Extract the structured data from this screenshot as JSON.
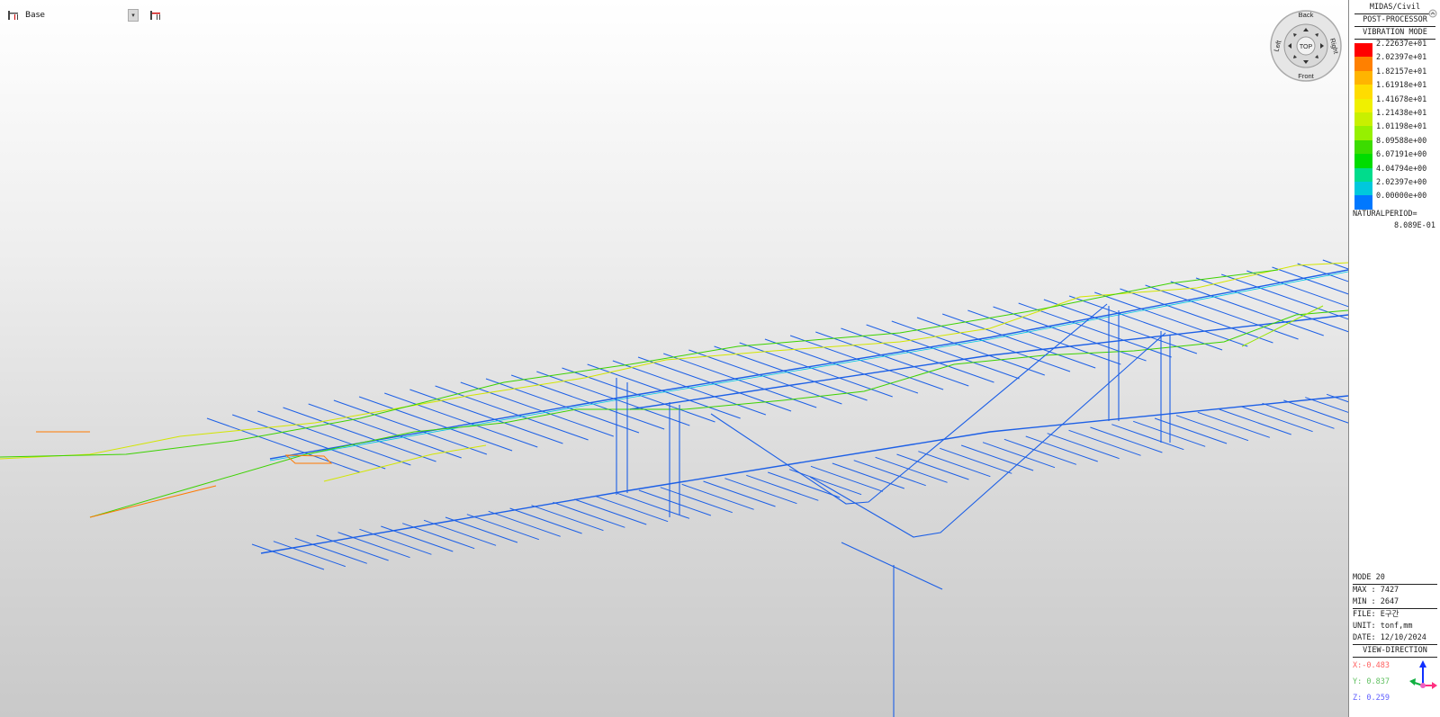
{
  "toolbar": {
    "layer_label": "Base",
    "layer_icon": "layer-icon",
    "layer_tool_icon": "layer-tool-icon",
    "dropdown_icon": "chevron-down-icon"
  },
  "navcube": {
    "back": "Back",
    "front": "Front",
    "left": "Left",
    "right": "Right",
    "top": "TOP"
  },
  "legend": {
    "title1": "MIDAS/Civil",
    "title2": "POST-PROCESSOR",
    "title3": "VIBRATION MODE",
    "scale": [
      {
        "value": "2.22637e+01",
        "color": "#ff0000"
      },
      {
        "value": "2.02397e+01",
        "color": "#ff8000"
      },
      {
        "value": "1.82157e+01",
        "color": "#ffb400"
      },
      {
        "value": "1.61918e+01",
        "color": "#ffdc00"
      },
      {
        "value": "1.41678e+01",
        "color": "#f0f000"
      },
      {
        "value": "1.21438e+01",
        "color": "#c8f000"
      },
      {
        "value": "1.01198e+01",
        "color": "#96f000"
      },
      {
        "value": "8.09588e+00",
        "color": "#3cdc00"
      },
      {
        "value": "6.07191e+00",
        "color": "#00dc00"
      },
      {
        "value": "4.04794e+00",
        "color": "#00dc8c"
      },
      {
        "value": "2.02397e+00",
        "color": "#00c8dc"
      },
      {
        "value": "0.00000e+00",
        "color": "#0078ff"
      }
    ],
    "natural_period_label": "NATURALPERIOD=",
    "natural_period_value": "8.089E-01",
    "mode": "MODE 20",
    "max": "MAX : 7427",
    "min": "MIN : 2647",
    "file": "FILE: E구간",
    "unit": "UNIT: tonf,mm",
    "date": "DATE: 12/10/2024",
    "view_direction": "VIEW-DIRECTION",
    "vx": "X:-0.483",
    "vy": "Y: 0.837",
    "vz": "Z: 0.259",
    "vx_color": "#ff6060",
    "vy_color": "#60c060",
    "vz_color": "#6060ff"
  }
}
